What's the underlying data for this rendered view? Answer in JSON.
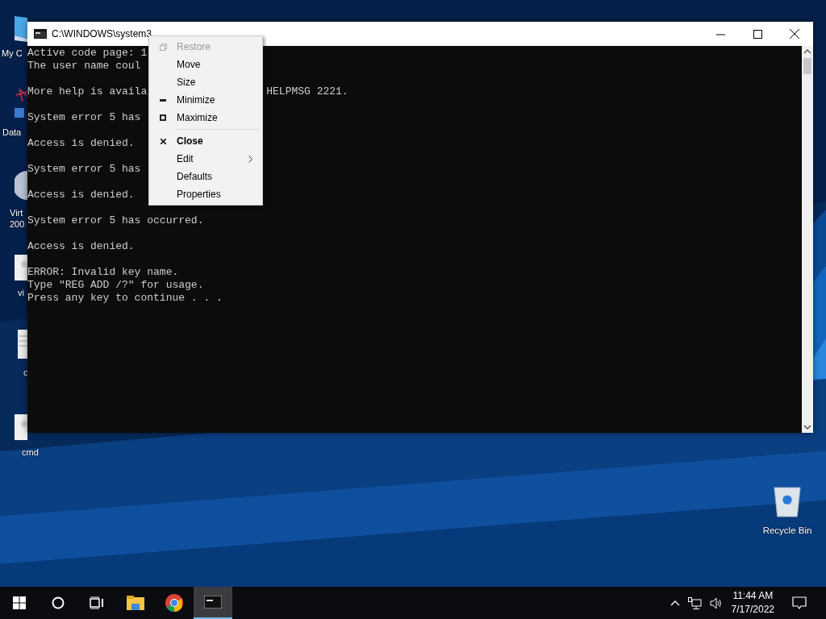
{
  "desktop_icons": [
    {
      "label": "My C",
      "kind": "computer"
    },
    {
      "label": "Data",
      "kind": "network"
    },
    {
      "label": "Virt\n200",
      "kind": "sphere"
    },
    {
      "label": "vi",
      "kind": "document"
    },
    {
      "label": "c",
      "kind": "text"
    },
    {
      "label": "cmd",
      "kind": "document"
    },
    {
      "label": "Recycle Bin",
      "kind": "recycle"
    }
  ],
  "window": {
    "title": "C:\\WINDOWS\\system3",
    "console_blocks": [
      {
        "lines": [
          {
            "text": "Active code page: 1"
          },
          {
            "text": "The user name coul"
          }
        ]
      },
      {
        "lines": [
          {
            "text": "More help is availa",
            "tail": "HELPMSG 2221."
          }
        ]
      },
      {
        "lines": [
          {
            "text": "System error 5 has"
          }
        ]
      },
      {
        "lines": [
          {
            "text": "Access is denied."
          }
        ]
      },
      {
        "lines": [
          {
            "text": "System error 5 has"
          }
        ]
      },
      {
        "lines": [
          {
            "text": "Access is denied."
          }
        ]
      },
      {
        "lines": [
          {
            "text": "System error 5 has occurred."
          }
        ]
      },
      {
        "lines": [
          {
            "text": "Access is denied."
          }
        ]
      },
      {
        "lines": [
          {
            "text": "ERROR: Invalid key name."
          },
          {
            "text": "Type \"REG ADD /?\" for usage."
          },
          {
            "text": "Press any key to continue . . ."
          }
        ]
      }
    ]
  },
  "context_menu": [
    {
      "label": "Restore",
      "kind": "restore",
      "disabled": true,
      "default": false,
      "submenu": false
    },
    {
      "label": "Move",
      "kind": "plain",
      "disabled": false,
      "default": false,
      "submenu": false
    },
    {
      "label": "Size",
      "kind": "plain",
      "disabled": false,
      "default": false,
      "submenu": false
    },
    {
      "label": "Minimize",
      "kind": "minimize",
      "disabled": false,
      "default": false,
      "submenu": false
    },
    {
      "label": "Maximize",
      "kind": "maximize",
      "disabled": false,
      "default": false,
      "submenu": false,
      "separator_after": true
    },
    {
      "label": "Close",
      "kind": "close",
      "disabled": false,
      "default": true,
      "submenu": false
    },
    {
      "label": "Edit",
      "kind": "plain",
      "disabled": false,
      "default": false,
      "submenu": true
    },
    {
      "label": "Defaults",
      "kind": "plain",
      "disabled": false,
      "default": false,
      "submenu": false
    },
    {
      "label": "Properties",
      "kind": "plain",
      "disabled": false,
      "default": false,
      "submenu": false
    }
  ],
  "taskbar": {
    "items": [
      {
        "kind": "start",
        "selected": false
      },
      {
        "kind": "search",
        "selected": false
      },
      {
        "kind": "taskview",
        "selected": false
      },
      {
        "kind": "explorer",
        "selected": false
      },
      {
        "kind": "chrome",
        "selected": false
      },
      {
        "kind": "console",
        "selected": true
      }
    ],
    "time": "11:44 AM",
    "date": "7/17/2022"
  }
}
